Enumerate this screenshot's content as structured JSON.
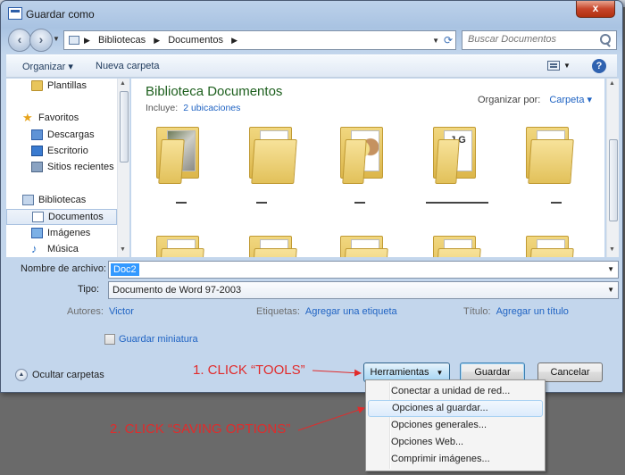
{
  "window": {
    "title": "Guardar como",
    "close_label": "x"
  },
  "address": {
    "crumbs": [
      "Bibliotecas",
      "Documentos"
    ],
    "search_placeholder": "Buscar Documentos"
  },
  "toolbar": {
    "organize": "Organizar",
    "new_folder": "Nueva carpeta"
  },
  "nav": {
    "items": [
      {
        "label": "Plantillas",
        "icon": "folder-icon"
      },
      {
        "label": "Favoritos",
        "icon": "star-icon"
      },
      {
        "label": "Descargas",
        "icon": "downloads-icon"
      },
      {
        "label": "Escritorio",
        "icon": "desktop-icon"
      },
      {
        "label": "Sitios recientes",
        "icon": "recent-places-icon"
      },
      {
        "label": "Bibliotecas",
        "icon": "libraries-icon"
      },
      {
        "label": "Documentos",
        "icon": "documents-icon"
      },
      {
        "label": "Imágenes",
        "icon": "pictures-icon"
      },
      {
        "label": "Música",
        "icon": "music-icon"
      }
    ]
  },
  "content": {
    "library_title": "Biblioteca Documentos",
    "includes_label": "Incluye:",
    "includes_link": "2 ubicaciones",
    "arrange_label": "Organizar por:",
    "arrange_value": "Carpeta"
  },
  "form": {
    "filename_label": "Nombre de archivo:",
    "filename_value": "Doc2",
    "type_label": "Tipo:",
    "type_value": "Documento de Word 97-2003",
    "authors_label": "Autores:",
    "authors_value": "Victor",
    "tags_label": "Etiquetas:",
    "tags_value": "Agregar una etiqueta",
    "title_label": "Título:",
    "title_value": "Agregar un título",
    "thumbnail_label": "Guardar miniatura"
  },
  "footer": {
    "hide_folders": "Ocultar carpetas",
    "tools_label": "Herramientas",
    "save_label": "Guardar",
    "cancel_label": "Cancelar"
  },
  "tools_menu": {
    "items": [
      "Conectar a unidad de red...",
      "Opciones al guardar...",
      "Opciones generales...",
      "Opciones Web...",
      "Comprimir imágenes..."
    ],
    "highlighted_index": 1
  },
  "annotations": {
    "step1": "1. CLICK “TOOLS”",
    "step2": "2. CLICK “SAVING OPTIONS”",
    "color": "#e12b2b"
  }
}
